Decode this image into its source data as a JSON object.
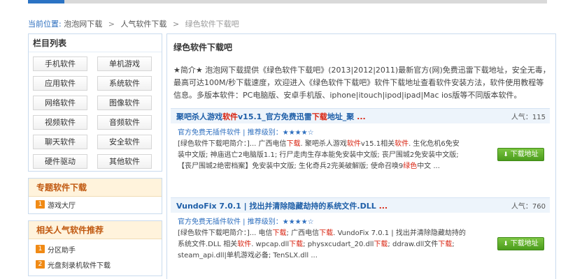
{
  "breadcrumb": {
    "current_label": "当前位置:",
    "items": [
      "泡泡网下载",
      "人气软件下载",
      "绿色软件下载吧"
    ],
    "separator": ">"
  },
  "sidebar": {
    "category_title": "栏目列表",
    "categories": [
      "手机软件",
      "单机游戏",
      "应用软件",
      "系统软件",
      "网络软件",
      "图像软件",
      "视频软件",
      "音频软件",
      "聊天软件",
      "安全软件",
      "硬件驱动",
      "其他软件"
    ],
    "topic_title": "专题软件下载",
    "topic_items": [
      {
        "num": "1",
        "label": "游戏大厅"
      }
    ],
    "hot_title": "相关人气软件推荐",
    "hot_items": [
      {
        "num": "1",
        "label": "分区助手"
      },
      {
        "num": "2",
        "label": "光盘刻录机软件下载"
      }
    ]
  },
  "main": {
    "title": "绿色软件下载吧",
    "intro": "★简介★ 泡泡网下载提供《绿色软件下载吧》(2013|2012|2011)最新官方(网)免费迅雷下载地址，安全无毒，最高可达100M/秒下载速度，欢迎进入《绿色软件下载吧》软件下载地址查看软件安装方法，软件使用教程等信息。多版本软件：PC电脑版、安卓手机版、iphone|itouch|ipod|ipad|Mac ios版等不同版本软件。",
    "download_label": "下载地址",
    "items": [
      {
        "title_a": "聚吧杀人游戏",
        "title_b": "软件",
        "title_c": "v15.1_官方免费迅雷",
        "title_d": "下载",
        "title_e": "地址_聚",
        "title_dots": " ...",
        "popularity": "人气：115",
        "meta_a": "官方免费无插件软件",
        "meta_b": " | 推荐级别：",
        "stars": "★★★★☆",
        "desc": [
          {
            "t": "[绿色软件下载吧简介：]... 广西电信",
            "r": false
          },
          {
            "t": "下载",
            "r": true
          },
          {
            "t": ". 聚吧杀人游戏",
            "r": false
          },
          {
            "t": "软件",
            "r": true
          },
          {
            "t": "v15.1相关",
            "r": false
          },
          {
            "t": "软件",
            "r": true
          },
          {
            "t": ". 生化危机6免安装中文版; 神庙逃亡2电脑版1.1; 行尸走肉生存本能免安装中文版; 丧尸围城2免安装中文版; 【丧尸围城2绝密档案】免安装中文版; 生化奇兵2完美破解版; 使命召唤9",
            "r": false
          },
          {
            "t": "绿色",
            "r": true
          },
          {
            "t": "中文 ...",
            "r": false
          }
        ]
      },
      {
        "title_a": "VundoFix 7.0.1 | 找出并清除隐藏劫持的系统文件.DLL",
        "title_b": "",
        "title_c": "",
        "title_d": "",
        "title_e": "",
        "title_dots": " ...",
        "popularity": "人气：760",
        "meta_a": "官方免费无插件软件",
        "meta_b": " | 推荐级别：",
        "stars": "★★★★☆",
        "desc": [
          {
            "t": "[绿色软件下载吧简介：]... 电信",
            "r": false
          },
          {
            "t": "下载",
            "r": true
          },
          {
            "t": "; 广西电信",
            "r": false
          },
          {
            "t": "下载",
            "r": true
          },
          {
            "t": ". VundoFix 7.0.1 | 找出并清除隐藏劫持的系统文件.DLL 相关",
            "r": false
          },
          {
            "t": "软件",
            "r": true
          },
          {
            "t": ". wpcap.dll",
            "r": false
          },
          {
            "t": "下载",
            "r": true
          },
          {
            "t": "; physxcudart_20.dll",
            "r": false
          },
          {
            "t": "下载",
            "r": true
          },
          {
            "t": "; ddraw.dll文件",
            "r": false
          },
          {
            "t": "下载",
            "r": true
          },
          {
            "t": "; steam_api.dll|单机游戏必备; TenSLX.dll ...",
            "r": false
          }
        ]
      }
    ]
  },
  "colors": {
    "link_blue": "#1f5fa8",
    "highlight_red": "#d8210e",
    "download_green": "#4b9c1c",
    "topic_orange": "#c0580f"
  }
}
